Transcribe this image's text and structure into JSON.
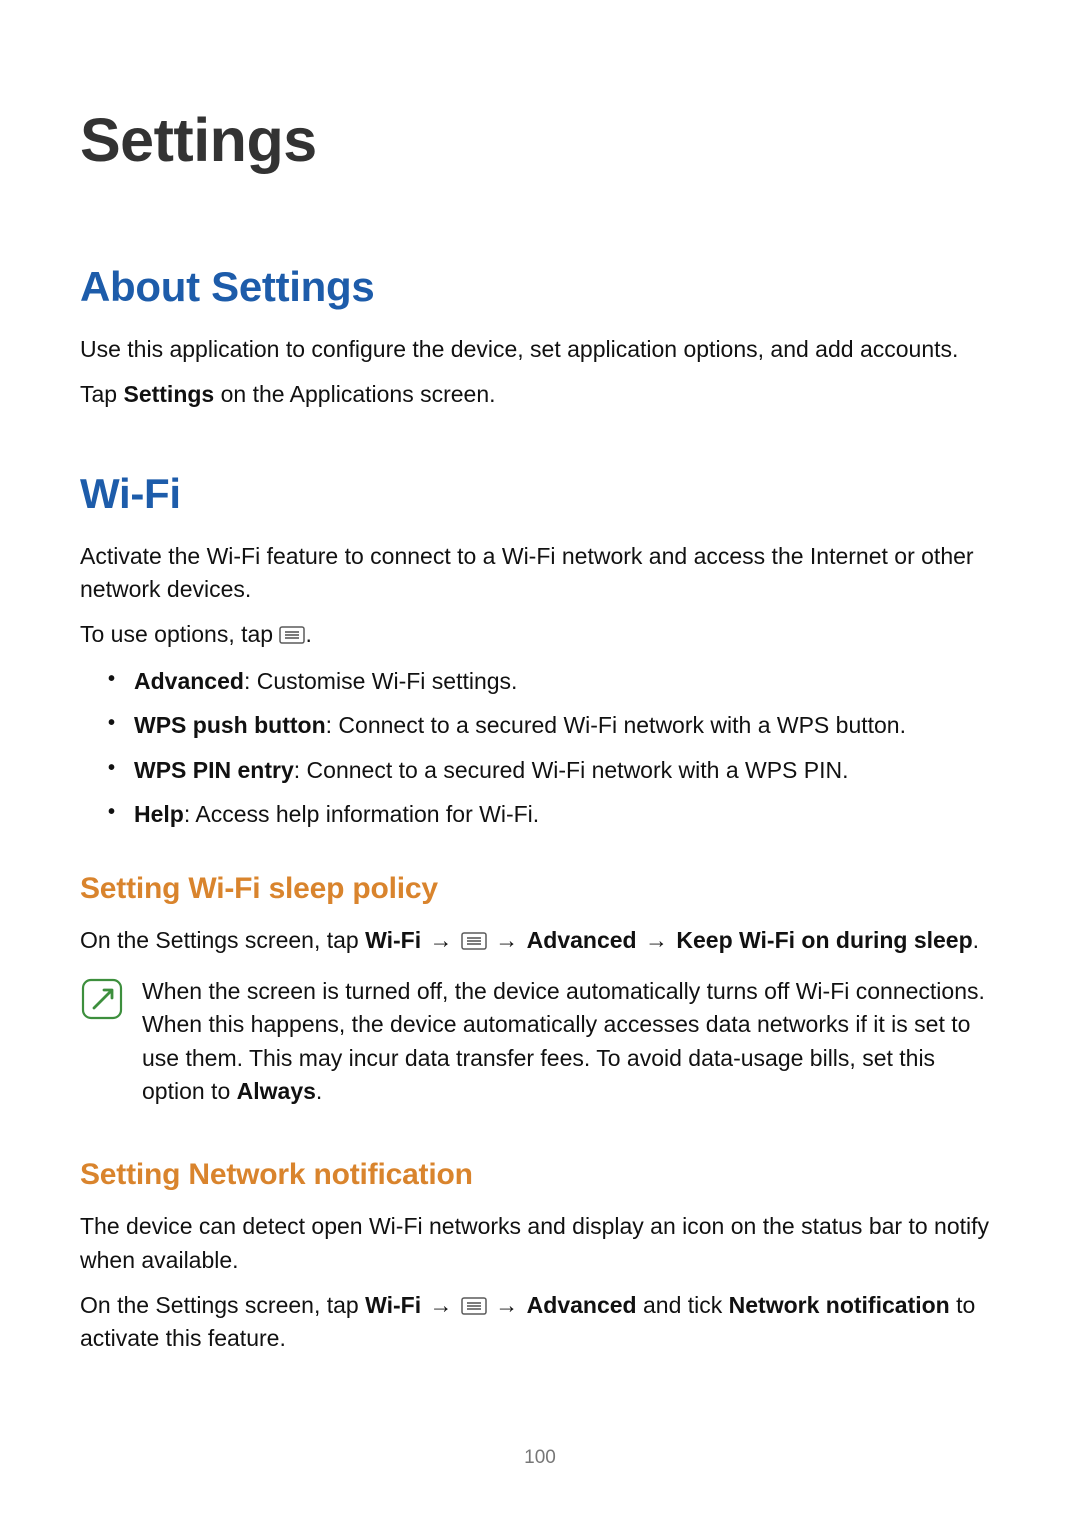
{
  "page_number": "100",
  "chapter_title": "Settings",
  "about": {
    "heading": "About Settings",
    "p1": "Use this application to configure the device, set application options, and add accounts.",
    "p2_prefix": "Tap ",
    "p2_bold": "Settings",
    "p2_suffix": " on the Applications screen."
  },
  "wifi": {
    "heading": "Wi-Fi",
    "intro": "Activate the Wi-Fi feature to connect to a Wi-Fi network and access the Internet or other network devices.",
    "options_prefix": "To use options, tap ",
    "options_suffix": ".",
    "options": [
      {
        "bold": "Advanced",
        "text": ": Customise Wi-Fi settings."
      },
      {
        "bold": "WPS push button",
        "text": ": Connect to a secured Wi-Fi network with a WPS button."
      },
      {
        "bold": "WPS PIN entry",
        "text": ": Connect to a secured Wi-Fi network with a WPS PIN."
      },
      {
        "bold": "Help",
        "text": ": Access help information for Wi-Fi."
      }
    ],
    "sleep": {
      "heading": "Setting Wi-Fi sleep policy",
      "p_prefix": "On the Settings screen, tap ",
      "wifi_bold": "Wi-Fi",
      "arrow1": " → ",
      "arrow2": " → ",
      "advanced_bold": "Advanced",
      "arrow3": " → ",
      "keep_bold": "Keep Wi-Fi on during sleep",
      "p_suffix": ".",
      "note_text": "When the screen is turned off, the device automatically turns off Wi-Fi connections. When this happens, the device automatically accesses data networks if it is set to use them. This may incur data transfer fees. To avoid data-usage bills, set this option to ",
      "note_bold": "Always",
      "note_suffix": "."
    },
    "network_notif": {
      "heading": "Setting Network notification",
      "p1": "The device can detect open Wi-Fi networks and display an icon on the status bar to notify when available.",
      "p2_prefix": "On the Settings screen, tap ",
      "wifi_bold": "Wi-Fi",
      "arrow1": " → ",
      "arrow2": " → ",
      "advanced_bold": "Advanced",
      "and_text": " and tick ",
      "netnotif_bold": "Network notification",
      "p2_suffix": " to activate this feature."
    }
  }
}
